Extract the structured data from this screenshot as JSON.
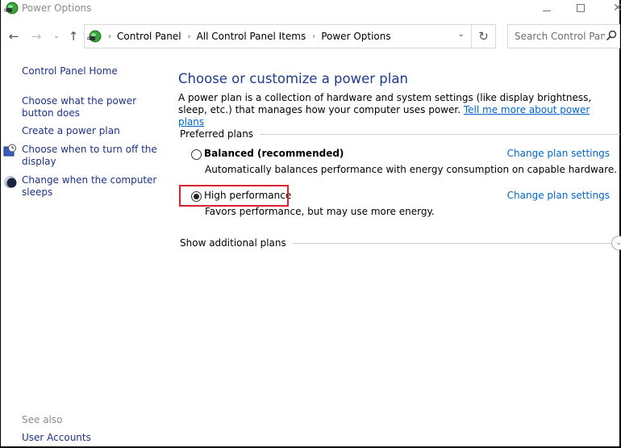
{
  "window": {
    "title": "Power Options",
    "app_icon": "power-options-icon",
    "controls": {
      "minimize": "minimize-icon",
      "maximize": "maximize-icon",
      "close": "✕"
    }
  },
  "navigation": {
    "back": "←",
    "forward": "→",
    "recent": "⌄",
    "up": "↑",
    "breadcrumbs": [
      "Control Panel",
      "All Control Panel Items",
      "Power Options"
    ],
    "separator": "›",
    "dropdown": "⌄",
    "refresh": "↻",
    "search": {
      "value": "",
      "placeholder": "Search Control Panel"
    }
  },
  "sidebar": {
    "home": "Control Panel Home",
    "items": [
      {
        "label": "Choose what the power button does",
        "icon": ""
      },
      {
        "label": "Create a power plan",
        "icon": ""
      },
      {
        "label": "Choose when to turn off the display",
        "icon": "display-clock-icon"
      },
      {
        "label": "Change when the computer sleeps",
        "icon": "sleep-moon-icon"
      }
    ],
    "see_also": {
      "heading": "See also",
      "items": [
        {
          "label": "User Accounts"
        }
      ]
    }
  },
  "main": {
    "title": "Choose or customize a power plan",
    "intro": "A power plan is a collection of hardware and system settings (like display brightness, sleep, etc.) that manages how your computer uses power.",
    "intro_link": "Tell me more about power plans",
    "preferred_header": "Preferred plans",
    "plans": [
      {
        "name": "Balanced (recommended)",
        "description": "Automatically balances performance with energy consumption on capable hardware.",
        "link": "Change plan settings",
        "selected": false
      },
      {
        "name": "High performance",
        "description": "Favors performance, but may use more energy.",
        "link": "Change plan settings",
        "selected": true
      }
    ],
    "additional_header": "Show additional plans",
    "expand_icon": "⌄",
    "highlight_color": "#d9222e"
  }
}
